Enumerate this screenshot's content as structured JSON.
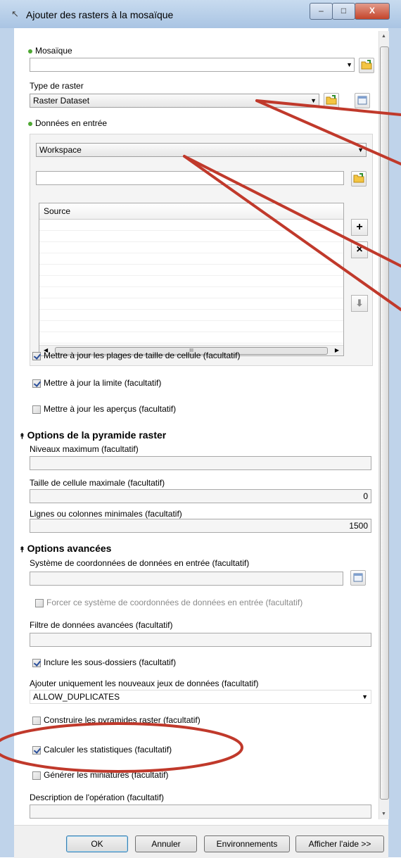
{
  "window": {
    "title": "Ajouter des rasters à la mosaïque",
    "min_glyph": "–",
    "max_glyph": "□",
    "close_glyph": "X"
  },
  "mosaic": {
    "label": "Mosaïque",
    "value": ""
  },
  "raster_type": {
    "label": "Type de raster",
    "value": "Raster Dataset"
  },
  "input": {
    "label": "Données en entrée",
    "workspace_value": "Workspace",
    "path_value": "",
    "list_header": "Source",
    "hscroll_grip": "III",
    "add_glyph": "+",
    "remove_glyph": "×",
    "down_glyph": "⬇"
  },
  "checks1": [
    {
      "label": "Mettre à jour les plages de taille de cellule (facultatif)",
      "checked": true
    },
    {
      "label": "Mettre à jour la limite (facultatif)",
      "checked": true
    },
    {
      "label": "Mettre à jour les aperçus (facultatif)",
      "checked": false
    }
  ],
  "pyramid": {
    "title": "Options de la pyramide raster",
    "max_levels_label": "Niveaux maximum (facultatif)",
    "max_levels_value": "",
    "max_cell_label": "Taille de cellule maximale (facultatif)",
    "max_cell_value": "0",
    "min_rows_label": "Lignes ou colonnes minimales (facultatif)",
    "min_rows_value": "1500"
  },
  "advanced": {
    "title": "Options avancées",
    "coord_label": "Système de coordonnées de données en entrée (facultatif)",
    "coord_value": "",
    "force_coord_label": "Forcer ce système de coordonnées de données en entrée (facultatif)",
    "filter_label": "Filtre de données avancées (facultatif)",
    "filter_value": "",
    "include_sub_label": "Inclure les sous-dossiers (facultatif)",
    "add_new_label": "Ajouter uniquement les nouveaux jeux de données (facultatif)",
    "add_new_value": "ALLOW_DUPLICATES",
    "build_pyr_label": "Construire les pyramides raster (facultatif)",
    "calc_stats_label": "Calculer les statistiques (facultatif)",
    "gen_thumbs_label": "Générer les miniatures (facultatif)",
    "desc_label": "Description de l'opération (facultatif)",
    "desc_value": ""
  },
  "section_caret": "⯭",
  "dropdown_arrow": "▼",
  "buttons": {
    "ok": "OK",
    "cancel": "Annuler",
    "env": "Environnements",
    "help": "Afficher l'aide >>"
  },
  "annotation_color": "#c0392b"
}
